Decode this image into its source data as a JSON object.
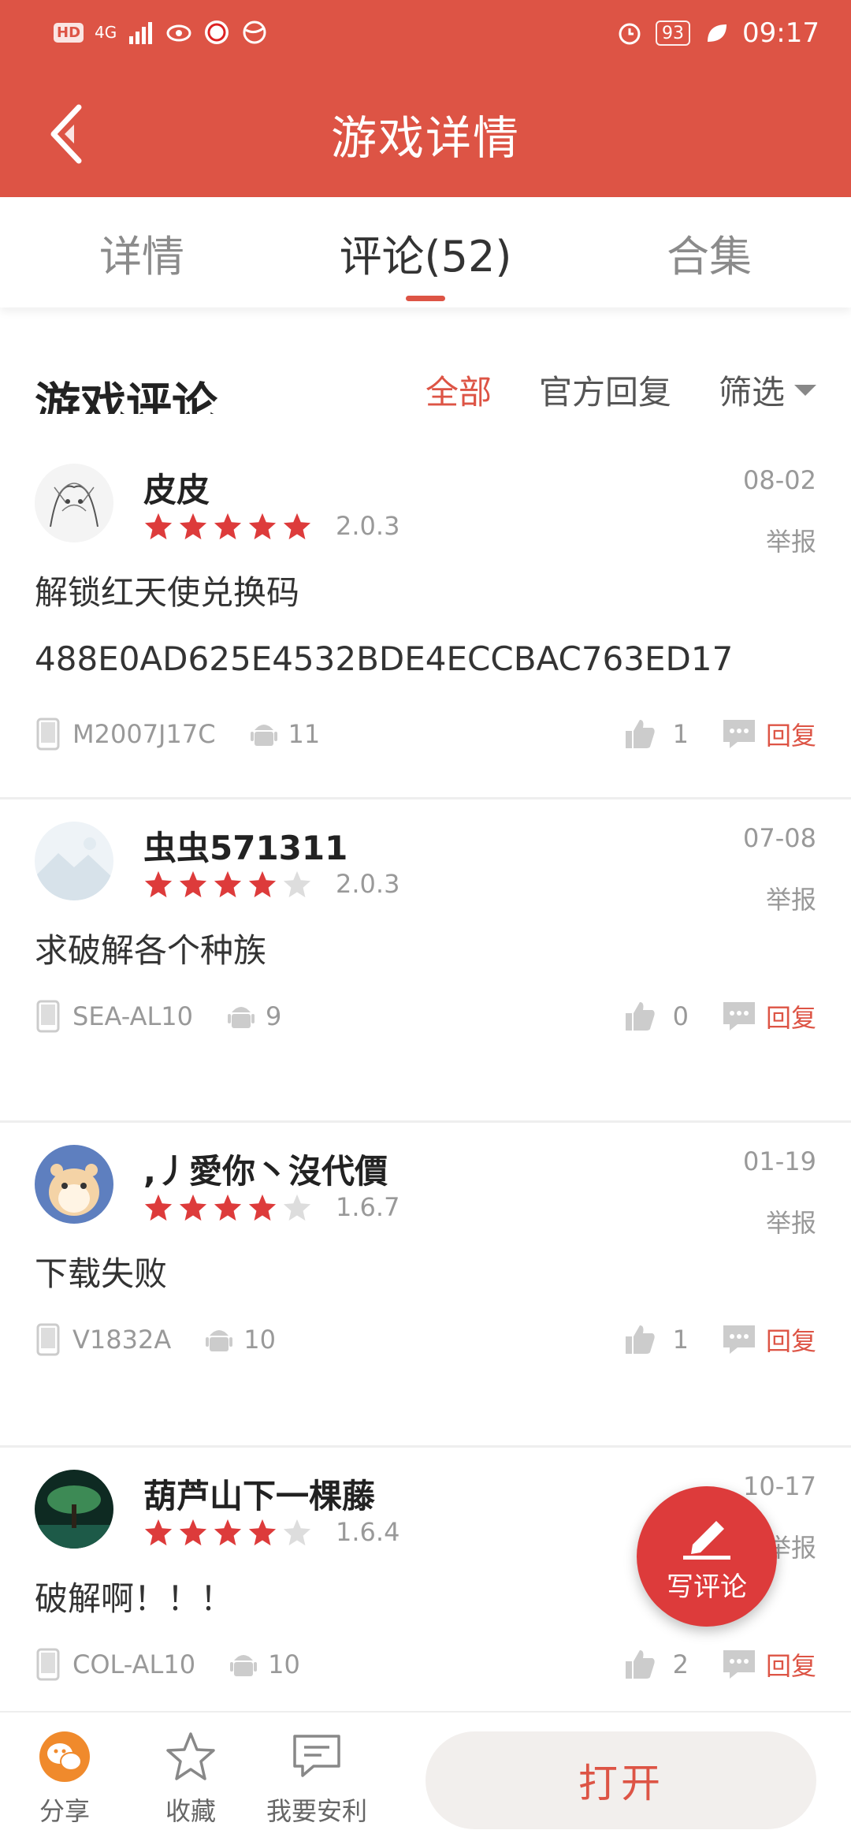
{
  "status_bar": {
    "hd": "HD",
    "network": "4G",
    "battery": "93",
    "time": "09:17"
  },
  "header": {
    "title": "游戏详情"
  },
  "tabs": [
    {
      "label": "详情"
    },
    {
      "label": "评论(52)"
    },
    {
      "label": "合集"
    }
  ],
  "section": {
    "title": "游戏评论",
    "filters": {
      "all": "全部",
      "official": "官方回复",
      "filter": "筛选"
    }
  },
  "comments": [
    {
      "user": "皮皮",
      "rating": 5,
      "version": "2.0.3",
      "date": "08-02",
      "report": "举报",
      "text_lines": [
        "解锁红天使兑换码",
        "488E0AD625E4532BDE4ECCBAC763ED17"
      ],
      "device": "M2007J17C",
      "android": "11",
      "likes": "1",
      "reply": "回复"
    },
    {
      "user": "虫虫571311",
      "rating": 4,
      "version": "2.0.3",
      "date": "07-08",
      "report": "举报",
      "text_lines": [
        "求破解各个种族"
      ],
      "device": "SEA-AL10",
      "android": "9",
      "likes": "0",
      "reply": "回复"
    },
    {
      "user": ",丿愛你丶沒代價",
      "rating": 4,
      "version": "1.6.7",
      "date": "01-19",
      "report": "举报",
      "text_lines": [
        "下载失败"
      ],
      "device": "V1832A",
      "android": "10",
      "likes": "1",
      "reply": "回复"
    },
    {
      "user": "葫芦山下一棵藤",
      "rating": 4,
      "version": "1.6.4",
      "date": "10-17",
      "report": "举报",
      "text_lines": [
        "破解啊！！！"
      ],
      "device": "COL-AL10",
      "android": "10",
      "likes": "2",
      "reply": "回复"
    }
  ],
  "fab": {
    "label": "写评论"
  },
  "bottom_bar": {
    "share": "分享",
    "favorite": "收藏",
    "recommend": "我要安利",
    "open": "打开"
  },
  "colors": {
    "brand": "#dd5445",
    "star": "#dd3b3b",
    "star_empty": "#dddddd"
  }
}
